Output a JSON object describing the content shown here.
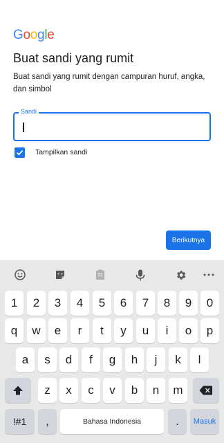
{
  "logo": {
    "letters": [
      "G",
      "o",
      "o",
      "g",
      "l",
      "e"
    ],
    "colors": [
      "#4285F4",
      "#EA4335",
      "#FBBC05",
      "#4285F4",
      "#34A853",
      "#EA4335"
    ]
  },
  "page": {
    "title": "Buat sandi yang rumit",
    "subtitle": "Buat sandi yang rumit dengan campuran huruf, angka, dan simbol"
  },
  "password_field": {
    "label": "Sandi",
    "value": ""
  },
  "show_password": {
    "label": "Tampilkan sandi",
    "checked": true
  },
  "next_button": {
    "label": "Berikutnya"
  },
  "keyboard": {
    "toolbar": [
      "emoji-icon",
      "sticker-icon",
      "clipboard-icon",
      "mic-icon",
      "gear-icon",
      "more-icon"
    ],
    "row1": [
      "1",
      "2",
      "3",
      "4",
      "5",
      "6",
      "7",
      "8",
      "9",
      "0"
    ],
    "row2": [
      "q",
      "w",
      "e",
      "r",
      "t",
      "y",
      "u",
      "i",
      "o",
      "p"
    ],
    "row3": [
      "a",
      "s",
      "d",
      "f",
      "g",
      "h",
      "j",
      "k",
      "l"
    ],
    "row4": [
      "z",
      "x",
      "c",
      "v",
      "b",
      "n",
      "m"
    ],
    "symbols_label": "!#1",
    "comma_label": ",",
    "space_label": "Bahasa Indonesia",
    "period_label": ".",
    "enter_label": "Masuk"
  },
  "colors": {
    "accent": "#1a73e8"
  }
}
